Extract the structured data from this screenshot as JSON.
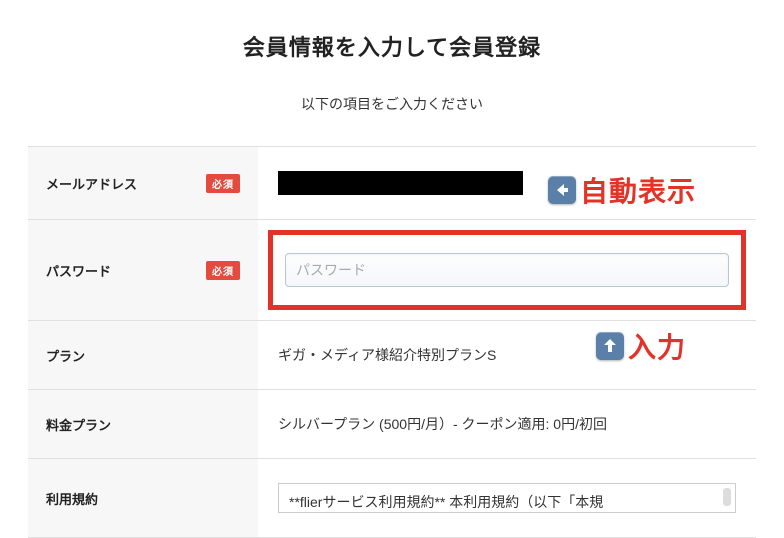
{
  "page_title": "会員情報を入力して会員登録",
  "instruction": "以下の項目をご入力ください",
  "required_badge": "必須",
  "fields": {
    "email": {
      "label": "メールアドレス"
    },
    "password": {
      "label": "パスワード",
      "placeholder": "パスワード"
    },
    "plan": {
      "label": "プラン",
      "value": "ギガ・メディア様紹介特別プランS"
    },
    "price_plan": {
      "label": "料金プラン",
      "value": "シルバープラン (500円/月）- クーポン適用: 0円/初回"
    },
    "terms": {
      "label": "利用規約",
      "text": "**flierサービス利用規約** 本利用規約（以下「本規"
    }
  },
  "annotations": {
    "auto_display": "自動表示",
    "input": "入力"
  }
}
